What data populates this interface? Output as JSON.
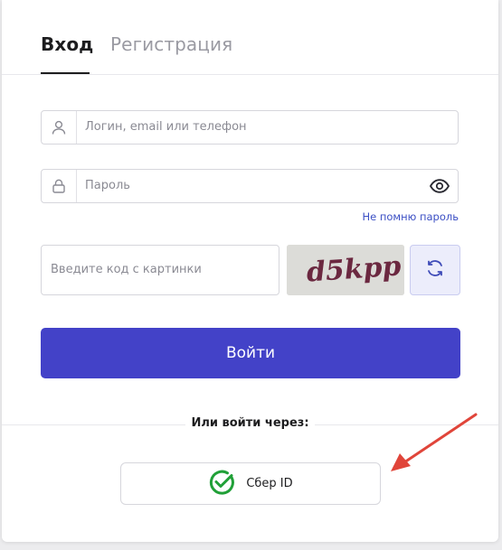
{
  "tabs": [
    {
      "label": "Вход",
      "active": true
    },
    {
      "label": "Регистрация",
      "active": false
    }
  ],
  "login_field": {
    "placeholder": "Логин, email или телефон",
    "icon": "user-icon"
  },
  "password_field": {
    "placeholder": "Пароль",
    "icon": "lock-icon",
    "toggle_icon": "eye-icon"
  },
  "forgot_link": "Не помню пароль",
  "captcha": {
    "placeholder": "Введите код с картинки",
    "image_text": "d5kpp",
    "refresh_icon": "refresh-icon"
  },
  "submit_label": "Войти",
  "alt_login": {
    "label": "Или войти через:",
    "sber_label": "Сбер ID",
    "sber_icon": "sber-check-icon"
  },
  "colors": {
    "primary": "#4342c8",
    "link": "#3b4fc4",
    "sber_green": "#21a038",
    "annotation_arrow": "#e0453a"
  }
}
